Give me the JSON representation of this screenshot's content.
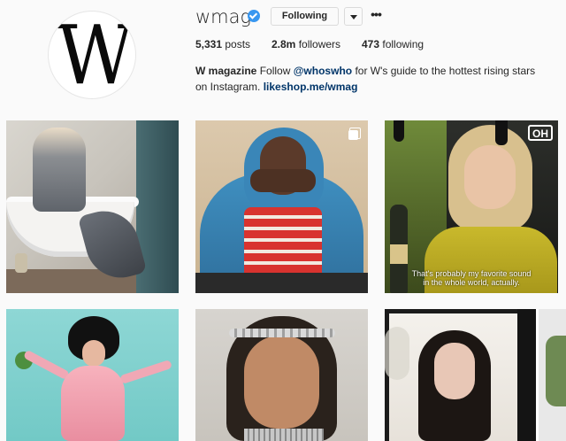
{
  "profile": {
    "avatar_letter": "W",
    "username": "wmag",
    "follow_button": "Following",
    "more_icon": "•••",
    "stats": {
      "posts_count": "5,331",
      "posts_label": "posts",
      "followers_count": "2.8m",
      "followers_label": "followers",
      "following_count": "473",
      "following_label": "following"
    },
    "bio": {
      "name": "W magazine",
      "text_before": "Follow",
      "mention": "@whoswho",
      "text_after": "for W's guide to the hottest rising stars on Instagram.",
      "link": "likeshop.me/wmag"
    }
  },
  "posts": {
    "p3_logo": "OH",
    "p3_caption_line1": "That's probably my favorite sound",
    "p3_caption_line2": "in the whole world, actually."
  },
  "colors": {
    "verified": "#3897f0",
    "link": "#003569",
    "border": "#dbdbdb",
    "background": "#fafafa"
  }
}
